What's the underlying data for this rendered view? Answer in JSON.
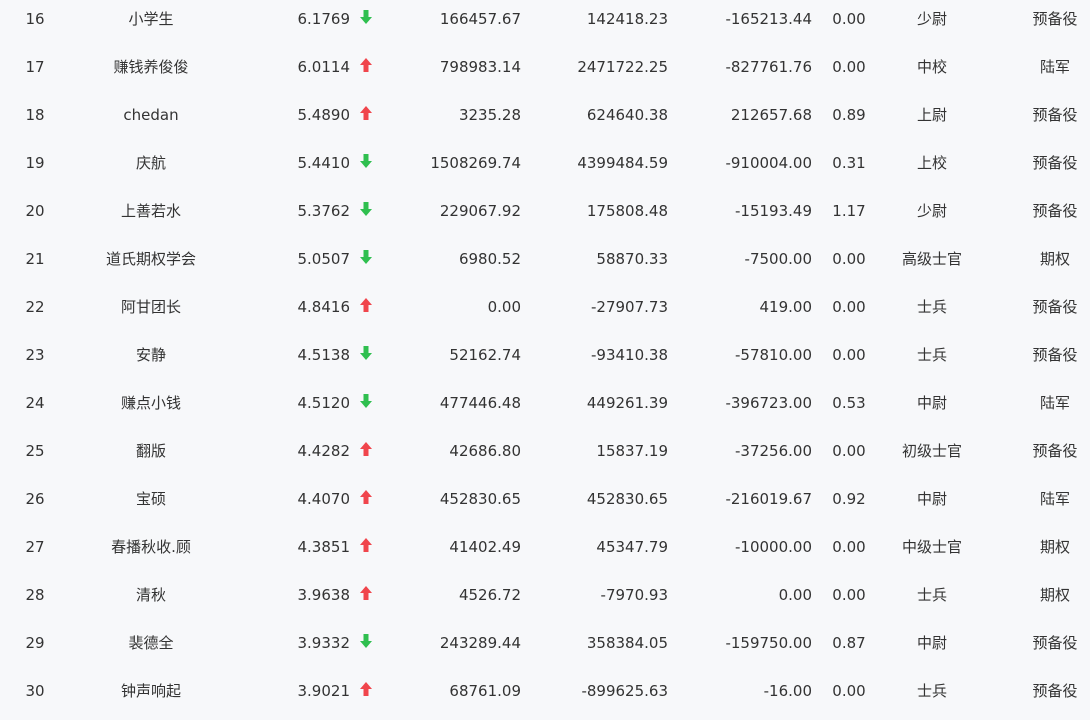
{
  "colors": {
    "up": "#f0454c",
    "down": "#2fbf4f",
    "text": "#333333",
    "background": "#f7f8fa"
  },
  "rows": [
    {
      "rank": "16",
      "name": "小学生",
      "score": "6.1769",
      "trend": "down",
      "value1": "166457.67",
      "value2": "142418.23",
      "value3": "-165213.44",
      "ratio": "0.00",
      "title": "少尉",
      "category": "预备役"
    },
    {
      "rank": "17",
      "name": "赚钱养俊俊",
      "score": "6.0114",
      "trend": "up",
      "value1": "798983.14",
      "value2": "2471722.25",
      "value3": "-827761.76",
      "ratio": "0.00",
      "title": "中校",
      "category": "陆军"
    },
    {
      "rank": "18",
      "name": "chedan",
      "score": "5.4890",
      "trend": "up",
      "value1": "3235.28",
      "value2": "624640.38",
      "value3": "212657.68",
      "ratio": "0.89",
      "title": "上尉",
      "category": "预备役"
    },
    {
      "rank": "19",
      "name": "庆航",
      "score": "5.4410",
      "trend": "down",
      "value1": "1508269.74",
      "value2": "4399484.59",
      "value3": "-910004.00",
      "ratio": "0.31",
      "title": "上校",
      "category": "预备役"
    },
    {
      "rank": "20",
      "name": "上善若水",
      "score": "5.3762",
      "trend": "down",
      "value1": "229067.92",
      "value2": "175808.48",
      "value3": "-15193.49",
      "ratio": "1.17",
      "title": "少尉",
      "category": "预备役"
    },
    {
      "rank": "21",
      "name": "道氏期权学会",
      "score": "5.0507",
      "trend": "down",
      "value1": "6980.52",
      "value2": "58870.33",
      "value3": "-7500.00",
      "ratio": "0.00",
      "title": "高级士官",
      "category": "期权"
    },
    {
      "rank": "22",
      "name": "阿甘团长",
      "score": "4.8416",
      "trend": "up",
      "value1": "0.00",
      "value2": "-27907.73",
      "value3": "419.00",
      "ratio": "0.00",
      "title": "士兵",
      "category": "预备役"
    },
    {
      "rank": "23",
      "name": "安静",
      "score": "4.5138",
      "trend": "down",
      "value1": "52162.74",
      "value2": "-93410.38",
      "value3": "-57810.00",
      "ratio": "0.00",
      "title": "士兵",
      "category": "预备役"
    },
    {
      "rank": "24",
      "name": "赚点小钱",
      "score": "4.5120",
      "trend": "down",
      "value1": "477446.48",
      "value2": "449261.39",
      "value3": "-396723.00",
      "ratio": "0.53",
      "title": "中尉",
      "category": "陆军"
    },
    {
      "rank": "25",
      "name": "翻版",
      "score": "4.4282",
      "trend": "up",
      "value1": "42686.80",
      "value2": "15837.19",
      "value3": "-37256.00",
      "ratio": "0.00",
      "title": "初级士官",
      "category": "预备役"
    },
    {
      "rank": "26",
      "name": "宝硕",
      "score": "4.4070",
      "trend": "up",
      "value1": "452830.65",
      "value2": "452830.65",
      "value3": "-216019.67",
      "ratio": "0.92",
      "title": "中尉",
      "category": "陆军"
    },
    {
      "rank": "27",
      "name": "春播秋收.顾",
      "score": "4.3851",
      "trend": "up",
      "value1": "41402.49",
      "value2": "45347.79",
      "value3": "-10000.00",
      "ratio": "0.00",
      "title": "中级士官",
      "category": "期权"
    },
    {
      "rank": "28",
      "name": "清秋",
      "score": "3.9638",
      "trend": "up",
      "value1": "4526.72",
      "value2": "-7970.93",
      "value3": "0.00",
      "ratio": "0.00",
      "title": "士兵",
      "category": "期权"
    },
    {
      "rank": "29",
      "name": "裴德全",
      "score": "3.9332",
      "trend": "down",
      "value1": "243289.44",
      "value2": "358384.05",
      "value3": "-159750.00",
      "ratio": "0.87",
      "title": "中尉",
      "category": "预备役"
    },
    {
      "rank": "30",
      "name": "钟声响起",
      "score": "3.9021",
      "trend": "up",
      "value1": "68761.09",
      "value2": "-899625.63",
      "value3": "-16.00",
      "ratio": "0.00",
      "title": "士兵",
      "category": "预备役"
    }
  ]
}
